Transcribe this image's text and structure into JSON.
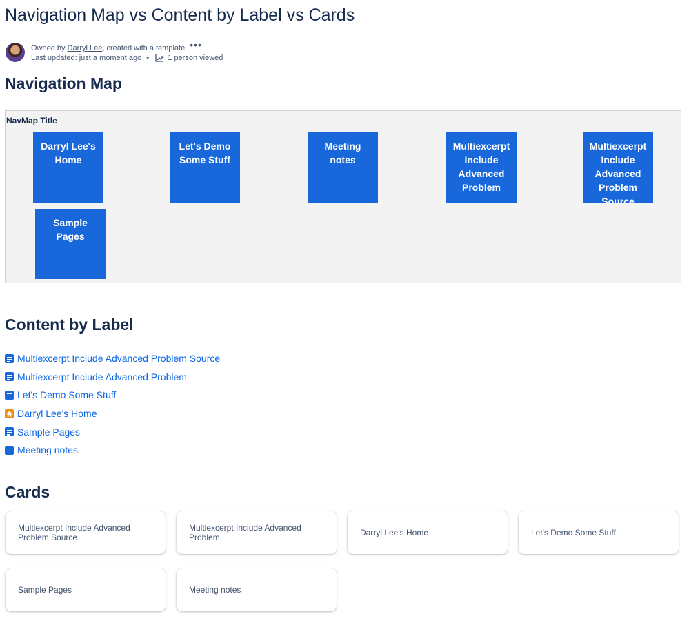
{
  "page": {
    "title": "Navigation Map vs Content by Label vs Cards"
  },
  "byline": {
    "owned_by_prefix": "Owned by ",
    "author": "Darryl Lee",
    "created_suffix": ", created with a template",
    "more_glyph": "•••",
    "last_updated": "Last updated: just a moment ago",
    "bullet": "•",
    "views": "1 person viewed"
  },
  "navmap_section": {
    "heading": "Navigation Map",
    "title": "NavMap Title",
    "tiles": [
      "Darryl Lee's Home",
      "Let's Demo Some Stuff",
      "Meeting notes",
      "Multiexcerpt Include Advanced Problem",
      "Multiexcerpt Include Advanced Problem Source",
      "Sample Pages"
    ],
    "tile_color": "#1868db"
  },
  "label_section": {
    "heading": "Content by Label",
    "items": [
      {
        "label": "Multiexcerpt Include Advanced Problem Source",
        "icon": "page-icon"
      },
      {
        "label": "Multiexcerpt Include Advanced Problem",
        "icon": "page-icon"
      },
      {
        "label": "Let's Demo Some Stuff",
        "icon": "page-icon"
      },
      {
        "label": "Darryl Lee's Home",
        "icon": "home-icon"
      },
      {
        "label": "Sample Pages",
        "icon": "page-icon"
      },
      {
        "label": "Meeting notes",
        "icon": "page-icon"
      }
    ]
  },
  "cards_section": {
    "heading": "Cards",
    "cards": [
      "Multiexcerpt Include Advanced Problem Source",
      "Multiexcerpt Include Advanced Problem",
      "Darryl Lee's Home",
      "Let's Demo Some Stuff",
      "Sample Pages",
      "Meeting notes"
    ]
  }
}
